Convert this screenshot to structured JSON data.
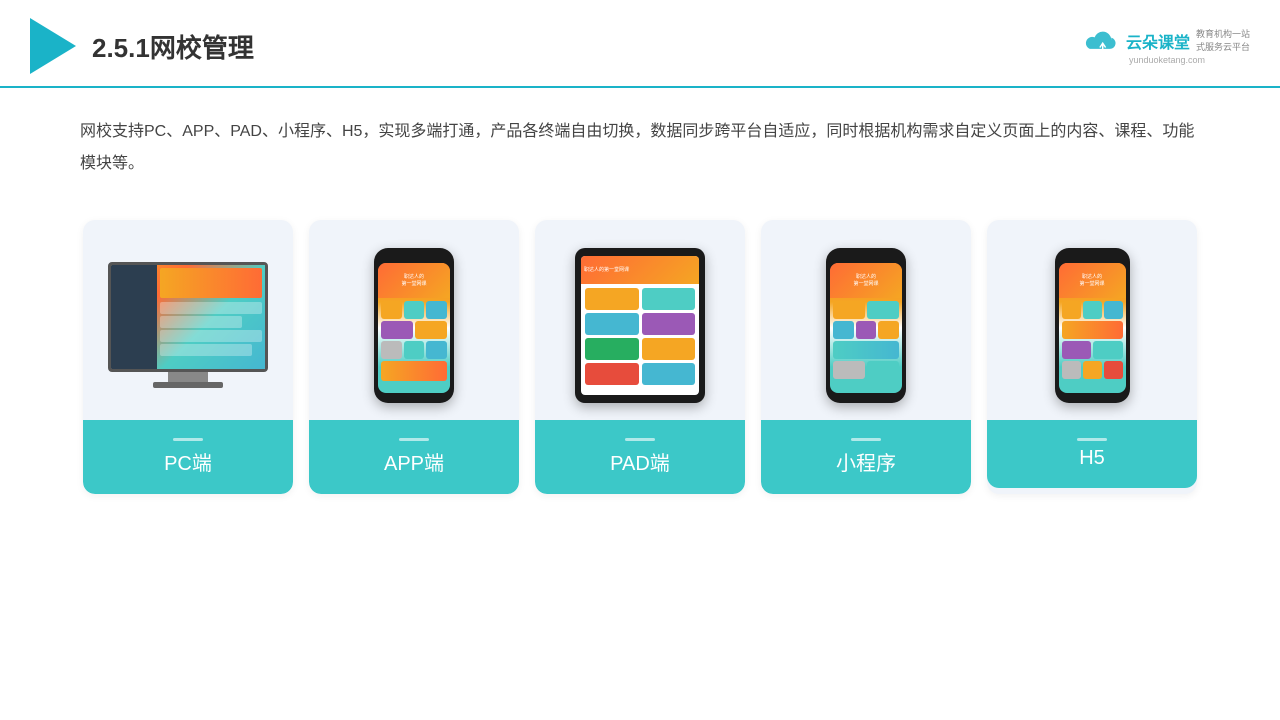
{
  "header": {
    "title": "2.5.1网校管理",
    "brand": {
      "name": "云朵课堂",
      "url": "yunduoketang.com",
      "tagline": "教育机构一站\n式服务云平台"
    }
  },
  "description": {
    "text": "网校支持PC、APP、PAD、小程序、H5，实现多端打通，产品各终端自由切换，数据同步跨平台自适应，同时根据机构需求自定义页面上的内容、课程、功能模块等。"
  },
  "cards": [
    {
      "id": "pc",
      "label": "PC端"
    },
    {
      "id": "app",
      "label": "APP端"
    },
    {
      "id": "pad",
      "label": "PAD端"
    },
    {
      "id": "miniprogram",
      "label": "小程序"
    },
    {
      "id": "h5",
      "label": "H5"
    }
  ]
}
